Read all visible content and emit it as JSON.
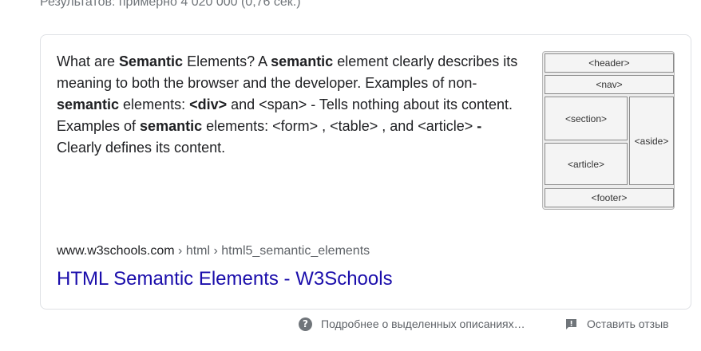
{
  "stats": {
    "text": "Результатов: примерно 4 020 000 (0,76 сек.)"
  },
  "snippet": {
    "segments": [
      {
        "t": "What are ",
        "b": false
      },
      {
        "t": "Semantic",
        "b": true
      },
      {
        "t": " Elements? A ",
        "b": false
      },
      {
        "t": "semantic",
        "b": true
      },
      {
        "t": " element clearly describes its meaning to both the browser and the developer. Examples of non-",
        "b": false
      },
      {
        "t": "semantic",
        "b": true
      },
      {
        "t": " elements: ",
        "b": false
      },
      {
        "t": "<div>",
        "b": true
      },
      {
        "t": " and <span> - Tells nothing about its content. Examples of ",
        "b": false
      },
      {
        "t": "semantic",
        "b": true
      },
      {
        "t": " elements: <form> , <table> , and <article> ",
        "b": false
      },
      {
        "t": "-",
        "b": true
      },
      {
        "t": " Clearly defines its content.",
        "b": false
      }
    ]
  },
  "thumbnail": {
    "header": "<header>",
    "nav": "<nav>",
    "section": "<section>",
    "article": "<article>",
    "aside": "<aside>",
    "footer": "<footer>"
  },
  "result": {
    "domain": "www.w3schools.com",
    "path": " › html › html5_semantic_elements",
    "title": "HTML Semantic Elements - W3Schools"
  },
  "footer": {
    "about_label": "Подробнее о выделенных описаниях…",
    "about_icon": "help-circle-icon",
    "feedback_label": "Оставить отзыв",
    "feedback_icon": "feedback-icon"
  },
  "colors": {
    "link": "#1a0dab",
    "text": "#202124",
    "muted": "#70757a"
  }
}
